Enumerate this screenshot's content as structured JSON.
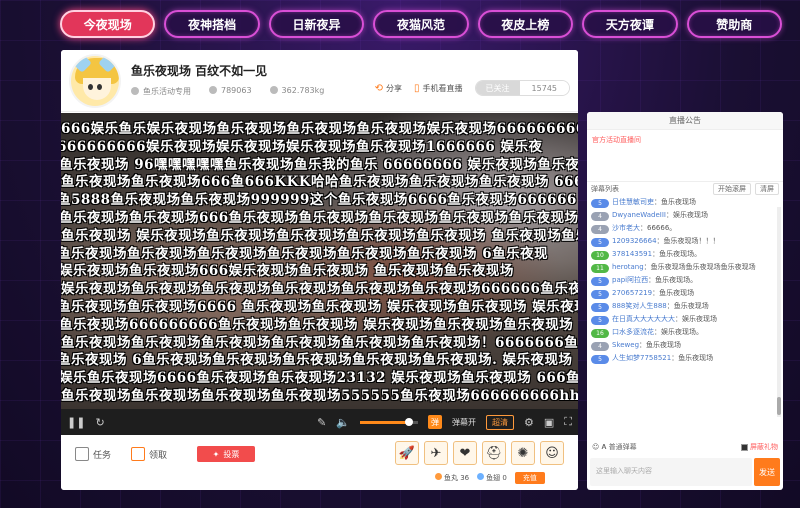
{
  "nav": {
    "tabs": [
      "今夜现场",
      "夜神搭档",
      "日新夜异",
      "夜猫风范",
      "夜皮上榜",
      "天方夜谭",
      "赞助商"
    ],
    "active_index": 0
  },
  "room": {
    "title": "鱼乐夜现场 百纹不如一见",
    "host": "鱼乐活动专用",
    "viewers": "789063",
    "weight": "362.783kg",
    "share_label": "分享",
    "mobile_label": "手机看直播",
    "follow_label": "已关注",
    "follow_count": "15745"
  },
  "danmu": [
    "666娱乐鱼乐娱乐夜现场鱼乐夜现场鱼乐夜现场鱼乐夜现场娱乐夜现场666666666666",
    "666666666娱乐夜现场娱乐夜现场娱乐夜现场鱼乐夜现场1666666        娱乐夜",
    "鱼乐夜现场 96嘿嘿嘿嘿嘿鱼乐夜现场鱼乐我的鱼乐 66666666  娱乐夜现场鱼乐夜现",
    "鱼乐夜现场鱼乐夜现场666鱼666KKK哈哈鱼乐夜现场鱼乐夜现场鱼乐夜现场  666",
    "鱼5888鱼乐夜现场鱼乐夜现场999999这个鱼乐夜现场6666鱼乐夜现场666666",
    "  鱼乐夜现场鱼乐夜现场666鱼乐夜现场鱼乐夜现场鱼乐夜现场鱼乐夜现场鱼乐夜现场鱼乐夜",
    "鱼乐夜现场 娱乐夜现场鱼乐夜现场鱼乐夜现场鱼乐夜现场鱼乐夜现场 鱼乐夜现场鱼乐夜现场",
    "鱼乐夜现场鱼乐夜现场鱼乐夜现场鱼乐夜现场鱼乐夜现场鱼乐夜现场        6鱼乐夜现",
    "娱乐夜现场鱼乐夜现场666娱乐夜现场鱼乐夜现场          鱼乐夜现场鱼乐夜现场",
    "娱乐夜现场鱼乐夜现场鱼乐夜现场鱼乐夜现场鱼乐夜现场鱼乐夜现场666666鱼乐夜现场",
    "鱼乐夜现场鱼乐夜现场6666 鱼乐夜现场鱼乐夜现场 娱乐夜现场鱼乐夜现场 娱乐夜现场",
    "     鱼乐夜现场666666666鱼乐夜现场鱼乐夜现场  娱乐夜现场鱼乐夜现场鱼乐夜现场",
    "鱼乐夜现场鱼乐夜现场鱼乐夜现场鱼乐夜现场鱼乐夜现场鱼乐夜现场！6666666鱼乐",
    "鱼乐夜现场      6鱼乐夜现场鱼乐夜现场鱼乐夜现场鱼乐夜现场鱼乐夜现场.   娱乐夜现场",
    "娱乐鱼乐夜现场6666鱼乐夜现场鱼乐夜现场23132 娱乐夜现场鱼乐夜现场      666鱼乐夜",
    "鱼乐夜现场鱼乐夜现场鱼乐夜现场鱼乐夜现场555555鱼乐夜现场666666666hh"
  ],
  "controls": {
    "danmu_on_label": "弹幕开",
    "quality_label": "超清",
    "volume_percent": 85
  },
  "bottom": {
    "task_label": "任务",
    "get_label": "领取",
    "vote_label": "投票",
    "gifts": [
      "rocket-gift",
      "plane-gift",
      "heart-gift",
      "helmet-gift",
      "firework-gift",
      "face-gift"
    ],
    "fish_balls": "鱼丸 36",
    "fish_wings": "鱼翅 0",
    "recharge_label": "充值"
  },
  "side": {
    "tab_label": "直播公告",
    "announcement": "官方活动直播间",
    "chat_label": "弹幕列表",
    "open_danmu_label": "开始滚屏",
    "clear_label": "清屏",
    "messages": [
      {
        "level": "5",
        "user": "日佳慧敏司吏",
        "text": "鱼乐夜现场"
      },
      {
        "level": "4",
        "user": "DwyaneWadeIII",
        "text": "娱乐夜现场"
      },
      {
        "level": "4",
        "user": "沙市老大",
        "text": "66666。"
      },
      {
        "level": "5",
        "user": "1209326664",
        "text": "鱼乐夜现场！！！"
      },
      {
        "level": "10",
        "user": "378143591",
        "text": "鱼乐夜现场。"
      },
      {
        "level": "11",
        "user": "herotang",
        "text": "鱼乐夜现场鱼乐夜现场鱼乐夜现场"
      },
      {
        "level": "5",
        "user": "papi阿拉西",
        "text": "鱼乐夜现场。"
      },
      {
        "level": "5",
        "user": "270657219",
        "text": "鱼乐夜现场"
      },
      {
        "level": "5",
        "user": "888笑对人生888",
        "text": "鱼乐夜现场"
      },
      {
        "level": "5",
        "user": "在日真大大大大大大",
        "text": "娱乐夜现场"
      },
      {
        "level": "16",
        "user": "口水多逐流花",
        "text": "娱乐夜现场。"
      },
      {
        "level": "4",
        "user": "Skeweg",
        "text": "鱼乐夜现场"
      },
      {
        "level": "5",
        "user": "人生如梦7758521",
        "text": "鱼乐夜现场"
      }
    ],
    "normal_danmu_label": "普通弹幕",
    "shield_gift_label": "屏蔽礼物",
    "input_placeholder": "这里输入聊天内容",
    "send_label": "发送"
  }
}
